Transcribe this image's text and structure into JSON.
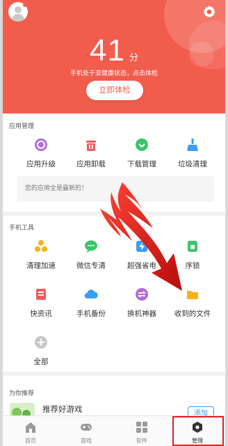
{
  "header": {
    "score": "41",
    "score_unit": "分",
    "status_text": "手机处于亚健康状态，点击体检",
    "check_button": "立即体检"
  },
  "app_management": {
    "title": "应用管理",
    "items": [
      {
        "label": "应用升级",
        "icon": "upgrade-icon",
        "color": "#b06be0"
      },
      {
        "label": "应用卸载",
        "icon": "uninstall-icon",
        "color": "#ef5b5b"
      },
      {
        "label": "下载管理",
        "icon": "download-icon",
        "color": "#3cc46c"
      },
      {
        "label": "垃圾清理",
        "icon": "broom-icon",
        "color": "#3b9df5"
      }
    ],
    "notice": "您的应用全是最新的！"
  },
  "phone_tools": {
    "title": "手机工具",
    "items": [
      {
        "label": "清理加速",
        "icon": "fan-icon",
        "color": "#f5b21f"
      },
      {
        "label": "微信专清",
        "icon": "wechat-icon",
        "color": "#3cc46c"
      },
      {
        "label": "超强省电",
        "icon": "battery-icon",
        "color": "#3b9df5"
      },
      {
        "label": "序锁",
        "icon": "app-lock-icon",
        "color": "#3cc46c"
      },
      {
        "label": "快资讯",
        "icon": "news-icon",
        "color": "#ef5b5b"
      },
      {
        "label": "手机备份",
        "icon": "cloud-icon",
        "color": "#3b9df5"
      },
      {
        "label": "换机神器",
        "icon": "swap-icon",
        "color": "#b06be0"
      },
      {
        "label": "收到的文件",
        "icon": "folder-icon",
        "color": "#f5b21f"
      },
      {
        "label": "全部",
        "icon": "plus-icon",
        "color": "#c8c8c8"
      }
    ]
  },
  "recommend": {
    "title": "为你推荐",
    "item_title": "推荐好游戏",
    "add_button": "添加"
  },
  "bottom_nav": [
    {
      "label": "首页",
      "icon": "home-icon"
    },
    {
      "label": "游戏",
      "icon": "gamepad-icon"
    },
    {
      "label": "软件",
      "icon": "apps-icon"
    },
    {
      "label": "管理",
      "icon": "manage-icon",
      "active": true
    }
  ],
  "colors": {
    "brand": "#f25c4d",
    "highlight": "#e02020"
  }
}
